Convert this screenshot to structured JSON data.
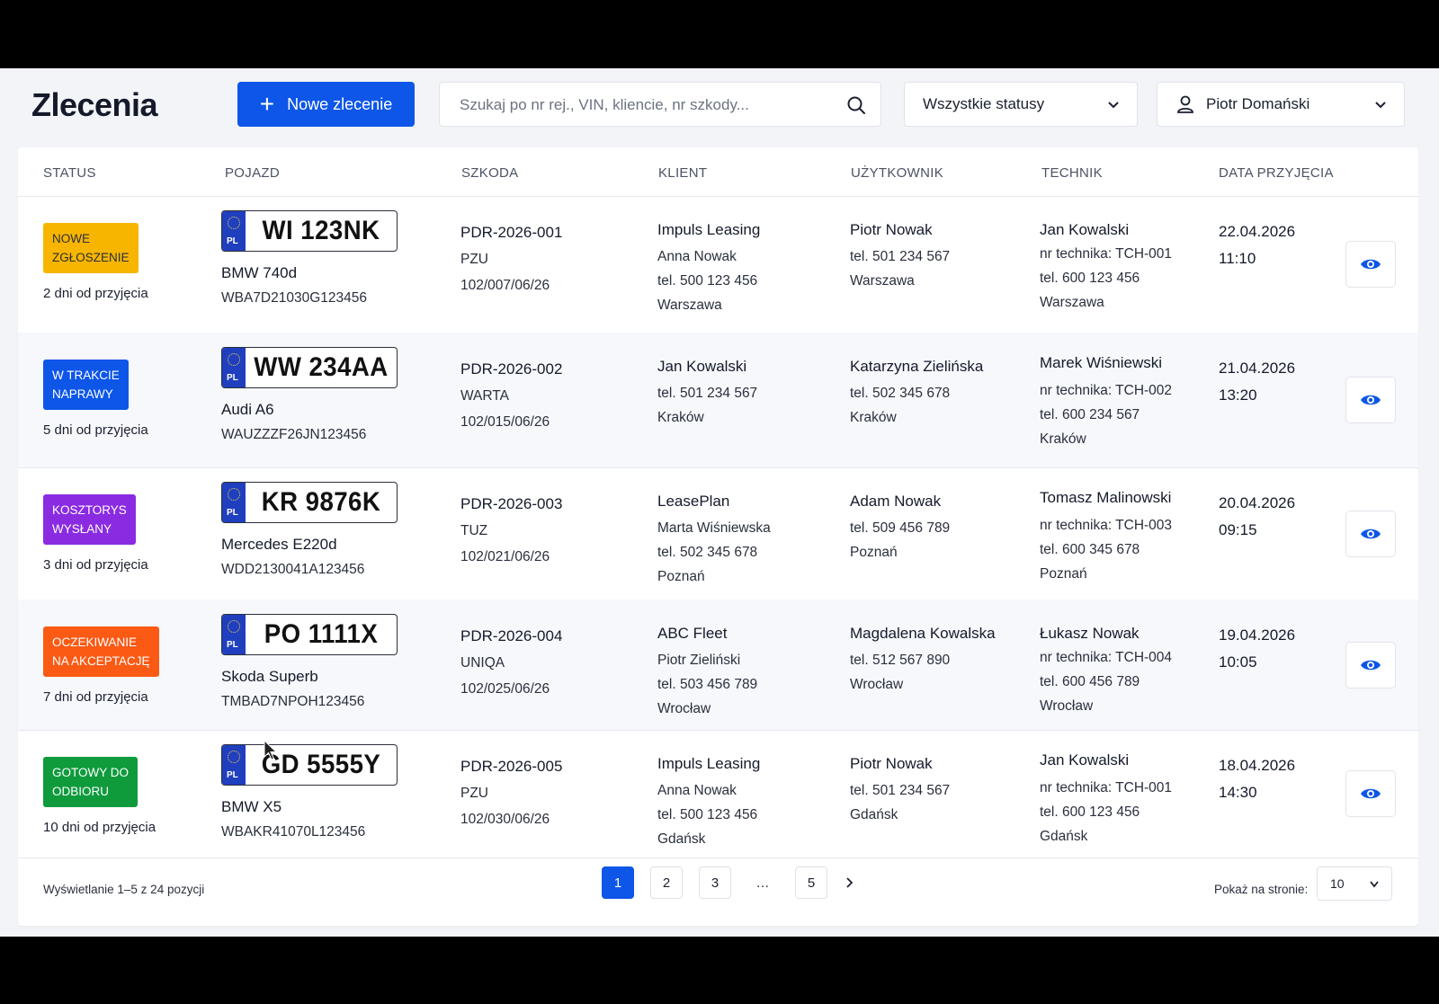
{
  "header": {
    "title": "Zlecenia",
    "new_button": "Nowe zlecenie",
    "search_placeholder": "Szukaj po nr rej., VIN, kliencie, nr szkody...",
    "status_filter": "Wszystkie statusy",
    "user": "Piotr Domański"
  },
  "columns": [
    "STATUS",
    "POJAZD",
    "SZKODA",
    "KLIENT",
    "UŻYTKOWNIK",
    "TECHNIK",
    "DATA PRZYJĘCIA"
  ],
  "colors": {
    "primary": "#0d56e8",
    "yellow": "#f7b500",
    "blue": "#0d56e8",
    "purple": "#8a2be2",
    "orange": "#fa5a14",
    "green": "#0f9a3c"
  },
  "rows": [
    {
      "status_line1": "NOWE",
      "status_line2": "ZGŁOSZENIE",
      "status_color": "#f7b500",
      "status_text_color": "#2a2f3d",
      "since": "2 dni od przyjęcia",
      "plate": "WI 123NK",
      "model": "BMW 740d",
      "vin": "WBA7D21030G123456",
      "claim_no": "PDR-2026-001",
      "insurer": "PZU",
      "claim_ref": "102/007/06/26",
      "client_name": "Impuls Leasing",
      "client_lines": [
        "Anna Nowak",
        "tel. 500 123 456",
        "Warszawa"
      ],
      "user_name": "Piotr Nowak",
      "user_lines": [
        "tel. 501 234 567",
        "Warszawa"
      ],
      "tech_name": "Jan Kowalski",
      "tech_lines": [
        "nr technika: TCH-001",
        "tel. 600 123 456",
        "Warszawa"
      ],
      "date": "22.04.2026",
      "time": "11:10"
    },
    {
      "status_line1": "W TRAKCIE",
      "status_line2": "NAPRAWY",
      "status_color": "#0d56e8",
      "status_text_color": "#ffffff",
      "since": "5 dni od przyjęcia",
      "plate": "WW 234AA",
      "model": "Audi A6",
      "vin": "WAUZZZF26JN123456",
      "claim_no": "PDR-2026-002",
      "insurer": "WARTA",
      "claim_ref": "102/015/06/26",
      "client_name": "Jan Kowalski",
      "client_lines": [
        "tel. 501 234 567",
        "Kraków"
      ],
      "user_name": "Katarzyna Zielińska",
      "user_lines": [
        "tel. 502 345 678",
        "Kraków"
      ],
      "tech_name": "Marek Wiśniewski",
      "tech_lines": [
        "nr technika: TCH-002",
        "tel. 600 234 567",
        "Kraków"
      ],
      "date": "21.04.2026",
      "time": "13:20"
    },
    {
      "status_line1": "KOSZTORYS",
      "status_line2": "WYSŁANY",
      "status_color": "#8a2be2",
      "status_text_color": "#ffffff",
      "since": "3 dni od przyjęcia",
      "plate": "KR 9876K",
      "model": "Mercedes E220d",
      "vin": "WDD2130041A123456",
      "claim_no": "PDR-2026-003",
      "insurer": "TUZ",
      "claim_ref": "102/021/06/26",
      "client_name": "LeasePlan",
      "client_lines": [
        "Marta Wiśniewska",
        "tel. 502 345 678",
        "Poznań"
      ],
      "user_name": "Adam Nowak",
      "user_lines": [
        "tel. 509 456 789",
        "Poznań"
      ],
      "tech_name": "Tomasz Malinowski",
      "tech_lines": [
        "nr technika: TCH-003",
        "tel. 600 345 678",
        "Poznań"
      ],
      "date": "20.04.2026",
      "time": "09:15"
    },
    {
      "status_line1": "OCZEKIWANIE",
      "status_line2": "NA AKCEPTACJĘ",
      "status_color": "#fa5a14",
      "status_text_color": "#ffffff",
      "since": "7 dni od przyjęcia",
      "plate": "PO 1111X",
      "model": "Skoda Superb",
      "vin": "TMBAD7NPOH123456",
      "claim_no": "PDR-2026-004",
      "insurer": "UNIQA",
      "claim_ref": "102/025/06/26",
      "client_name": "ABC Fleet",
      "client_lines": [
        "Piotr Zieliński",
        "tel. 503 456 789",
        "Wrocław"
      ],
      "user_name": "Magdalena Kowalska",
      "user_lines": [
        "tel. 512 567 890",
        "Wrocław"
      ],
      "tech_name": "Łukasz Nowak",
      "tech_lines": [
        "nr technika: TCH-004",
        "tel. 600 456 789",
        "Wrocław"
      ],
      "date": "19.04.2026",
      "time": "10:05"
    },
    {
      "status_line1": "GOTOWY DO",
      "status_line2": "ODBIORU",
      "status_color": "#0f9a3c",
      "status_text_color": "#ffffff",
      "since": "10 dni od przyjęcia",
      "plate": "GD 5555Y",
      "model": "BMW X5",
      "vin": "WBAKR41070L123456",
      "claim_no": "PDR-2026-005",
      "insurer": "PZU",
      "claim_ref": "102/030/06/26",
      "client_name": "Impuls Leasing",
      "client_lines": [
        "Anna Nowak",
        "tel. 500 123 456",
        "Gdańsk"
      ],
      "user_name": "Piotr Nowak",
      "user_lines": [
        "tel. 501 234 567",
        "Gdańsk"
      ],
      "tech_name": "Jan Kowalski",
      "tech_lines": [
        "nr technika: TCH-001",
        "tel. 600 123 456",
        "Gdańsk"
      ],
      "date": "18.04.2026",
      "time": "14:30"
    }
  ],
  "plate_country": "PL",
  "footer": {
    "info": "Wyświetlanie 1–5 z 24 pozycji",
    "pages": [
      "1",
      "2",
      "3",
      "…",
      "5"
    ],
    "active_page": "1",
    "per_page_label": "Pokaż na stronie:",
    "per_page_value": "10"
  },
  "icons": {
    "new": "plus-icon",
    "search": "search-icon",
    "user": "user-icon",
    "chevron": "chevron-down-icon",
    "view": "eye-icon",
    "next": "chevron-right-icon"
  }
}
